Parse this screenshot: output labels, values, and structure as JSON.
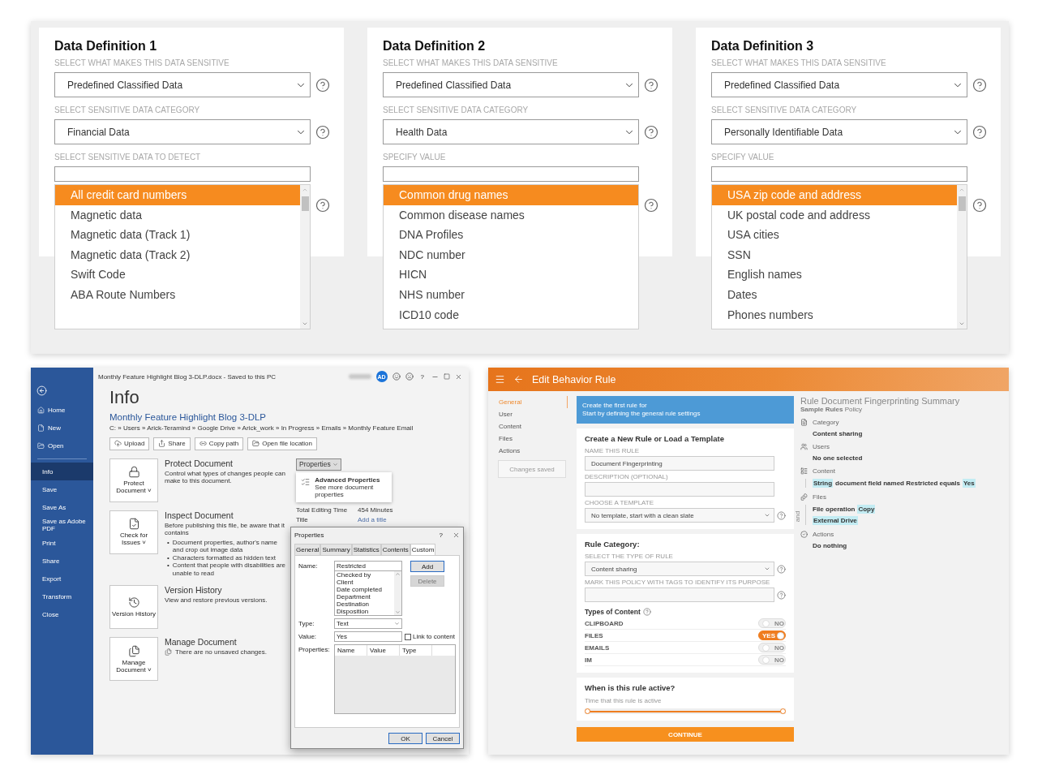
{
  "data_definitions": [
    {
      "title": "Data Definition 1",
      "fields": [
        {
          "kind": "select",
          "label": "SELECT WHAT MAKES THIS DATA SENSITIVE",
          "value": "Predefined Classified Data"
        },
        {
          "kind": "select",
          "label": "SELECT SENSITIVE DATA CATEGORY",
          "value": "Financial Data"
        },
        {
          "kind": "input",
          "label": "SELECT SENSITIVE DATA TO DETECT"
        }
      ],
      "scrollbar": true,
      "options": [
        {
          "label": "All credit card numbers",
          "selected": true
        },
        {
          "label": "Magnetic data",
          "selected": false
        },
        {
          "label": "Magnetic data (Track 1)",
          "selected": false
        },
        {
          "label": "Magnetic data (Track 2)",
          "selected": false
        },
        {
          "label": "Swift Code",
          "selected": false
        },
        {
          "label": "ABA Route Numbers",
          "selected": false
        }
      ]
    },
    {
      "title": "Data Definition 2",
      "fields": [
        {
          "kind": "select",
          "label": "SELECT WHAT MAKES THIS DATA SENSITIVE",
          "value": "Predefined Classified Data"
        },
        {
          "kind": "select",
          "label": "SELECT SENSITIVE DATA CATEGORY",
          "value": "Health Data"
        },
        {
          "kind": "input",
          "label": "SPECIFY VALUE"
        }
      ],
      "scrollbar": false,
      "options": [
        {
          "label": "Common drug names",
          "selected": true
        },
        {
          "label": "Common disease names",
          "selected": false
        },
        {
          "label": "DNA Profiles",
          "selected": false
        },
        {
          "label": "NDC number",
          "selected": false
        },
        {
          "label": "HICN",
          "selected": false
        },
        {
          "label": "NHS number",
          "selected": false
        },
        {
          "label": "ICD10 code",
          "selected": false
        }
      ]
    },
    {
      "title": "Data Definition 3",
      "fields": [
        {
          "kind": "select",
          "label": "SELECT WHAT MAKES THIS DATA SENSITIVE",
          "value": "Predefined Classified Data"
        },
        {
          "kind": "select",
          "label": "SELECT SENSITIVE DATA CATEGORY",
          "value": "Personally Identifiable Data"
        },
        {
          "kind": "input",
          "label": "SPECIFY VALUE"
        }
      ],
      "scrollbar": true,
      "options": [
        {
          "label": "USA zip code and address",
          "selected": true
        },
        {
          "label": "UK postal code and address",
          "selected": false
        },
        {
          "label": "USA cities",
          "selected": false
        },
        {
          "label": "SSN",
          "selected": false
        },
        {
          "label": "English names",
          "selected": false
        },
        {
          "label": "Dates",
          "selected": false
        },
        {
          "label": "Phones numbers",
          "selected": false
        }
      ]
    }
  ],
  "word": {
    "title_bar": "Monthly Feature Highlight Blog 3-DLP.docx  -  Saved to this PC",
    "avatar": "AD",
    "help": "?",
    "nav": [
      {
        "label": "Home",
        "selected": false
      },
      {
        "label": "New",
        "selected": false
      },
      {
        "label": "Open",
        "selected": false
      },
      {
        "label": "Info",
        "selected": true
      },
      {
        "label": "Save",
        "selected": false
      },
      {
        "label": "Save As",
        "selected": false
      },
      {
        "label": "Save as Adobe PDF",
        "selected": false
      },
      {
        "label": "Print",
        "selected": false
      },
      {
        "label": "Share",
        "selected": false
      },
      {
        "label": "Export",
        "selected": false
      },
      {
        "label": "Transform",
        "selected": false
      },
      {
        "label": "Close",
        "selected": false
      }
    ],
    "heading": "Info",
    "doc_title": "Monthly Feature Highlight Blog 3-DLP",
    "path": "C: » Users » Arick-Teramind » Google Drive » Arick_work » In Progress » Emails » Monthly Feature Email",
    "actions": [
      "Upload",
      "Share",
      "Copy path",
      "Open file location"
    ],
    "sections": [
      {
        "kind": "plain",
        "tile": "Protect Document",
        "caret": "˅",
        "title": "Protect Document",
        "text": "Control what types of changes people can make to this document."
      },
      {
        "kind": "plain",
        "tile": "Check for Issues",
        "caret": "˅",
        "title": "Inspect Document",
        "text": "Before publishing this file, be aware that it contains",
        "bullets": [
          {
            "mark": "•",
            "text": "Document properties, author's name and crop out image data"
          },
          {
            "mark": "•",
            "text": "Characters formatted as hidden text"
          },
          {
            "mark": "•",
            "text": "Content that people with disabilities are unable to read"
          }
        ]
      },
      {
        "kind": "plain",
        "tile": "Version History",
        "title": "Version History",
        "text": "View and restore previous versions."
      },
      {
        "kind": "note",
        "tile": "Manage Document",
        "caret": "˅",
        "title": "Manage Document",
        "text": "There are no unsaved changes."
      }
    ],
    "properties": {
      "button": "Properties",
      "menu_title": "Advanced Properties",
      "menu_text": "See more document properties",
      "rows": [
        {
          "label": "Total Editing Time",
          "value": "454 Minutes",
          "kind": "text"
        },
        {
          "label": "Title",
          "value": "Add a title",
          "kind": "link"
        }
      ]
    },
    "dialog": {
      "title": "Properties",
      "help": "?",
      "tabs": [
        {
          "label": "General",
          "selected": false
        },
        {
          "label": "Summary",
          "selected": false
        },
        {
          "label": "Statistics",
          "selected": false
        },
        {
          "label": "Contents",
          "selected": false
        },
        {
          "label": "Custom",
          "selected": true
        }
      ],
      "name_label": "Name:",
      "name_value": "Restricted",
      "list": [
        "Checked by",
        "Client",
        "Date completed",
        "Department",
        "Destination",
        "Disposition"
      ],
      "side_buttons": [
        {
          "label": "Add",
          "disabled": false
        },
        {
          "label": "Delete",
          "disabled": true
        }
      ],
      "type_label": "Type:",
      "type_value": "Text",
      "value_label": "Value:",
      "value": "Yes",
      "link": {
        "label": "Link to content",
        "checked": false
      },
      "properties_label": "Properties:",
      "columns": [
        "Name",
        "Value",
        "Type"
      ],
      "buttons": [
        "OK",
        "Cancel"
      ]
    }
  },
  "rule_editor": {
    "header": "Edit Behavior Rule",
    "nav": [
      {
        "label": "General",
        "selected": true
      },
      {
        "label": "User",
        "selected": false
      },
      {
        "label": "Content",
        "selected": false
      },
      {
        "label": "Files",
        "selected": false
      },
      {
        "label": "Actions",
        "selected": false
      }
    ],
    "status": "Changes saved",
    "banner": [
      "Create the first rule for",
      "Start by defining the general rule settings"
    ],
    "template_card": {
      "title": "Create a New Rule or Load a Template",
      "fields": [
        {
          "kind": "input",
          "label": "NAME THIS RULE",
          "value": "Document Fingerprinting",
          "help": false
        },
        {
          "kind": "input",
          "label": "DESCRIPTION (OPTIONAL)",
          "help": false
        },
        {
          "kind": "select",
          "label": "CHOOSE A TEMPLATE",
          "value": "No template, start with a clean slate",
          "help": true
        }
      ]
    },
    "category_card": {
      "title": "Rule Category:",
      "fields": [
        {
          "kind": "select",
          "label": "SELECT THE TYPE OF RULE",
          "value": "Content sharing",
          "help": true
        },
        {
          "kind": "input",
          "label": "MARK THIS POLICY WITH TAGS TO IDENTIFY ITS PURPOSE",
          "help": true
        }
      ],
      "types_title": "Types of Content",
      "toggles": [
        {
          "label": "CLIPBOARD",
          "on": false,
          "text": "NO"
        },
        {
          "label": "FILES",
          "on": true,
          "text": "YES"
        },
        {
          "label": "EMAILS",
          "on": false,
          "text": "NO"
        },
        {
          "label": "IM",
          "on": false,
          "text": "NO"
        }
      ]
    },
    "schedule_card": {
      "title": "When is this rule active?",
      "hint": "Time that this rule is active",
      "level": 1
    },
    "continue": "CONTINUE",
    "summary": {
      "title": "Rule Document Fingerprinting Summary",
      "subtitle": "**Sample Rules** Policy",
      "sections": [
        {
          "title": "Category",
          "bordered": false,
          "lines": [
            [
              {
                "text": "Content sharing",
                "tag": false
              }
            ]
          ]
        },
        {
          "title": "Users",
          "bordered": false,
          "lines": [
            [
              {
                "text": "No one selected",
                "tag": false
              }
            ]
          ]
        },
        {
          "title": "Content",
          "bordered": true,
          "lines": [
            [
              {
                "text": "String",
                "tag": true
              },
              {
                "text": "document field named Restricted equals",
                "tag": false
              },
              {
                "text": "Yes",
                "tag": true
              }
            ]
          ]
        },
        {
          "title": "Files",
          "bordered": true,
          "joiner": "and",
          "lines": [
            [
              {
                "text": "File operation",
                "tag": false
              },
              {
                "text": "Copy",
                "tag": true
              }
            ],
            [
              {
                "text": "External Drive",
                "tag": true
              }
            ]
          ]
        },
        {
          "title": "Actions",
          "bordered": false,
          "lines": [
            [
              {
                "text": "Do nothing",
                "tag": false
              }
            ]
          ]
        }
      ]
    }
  }
}
